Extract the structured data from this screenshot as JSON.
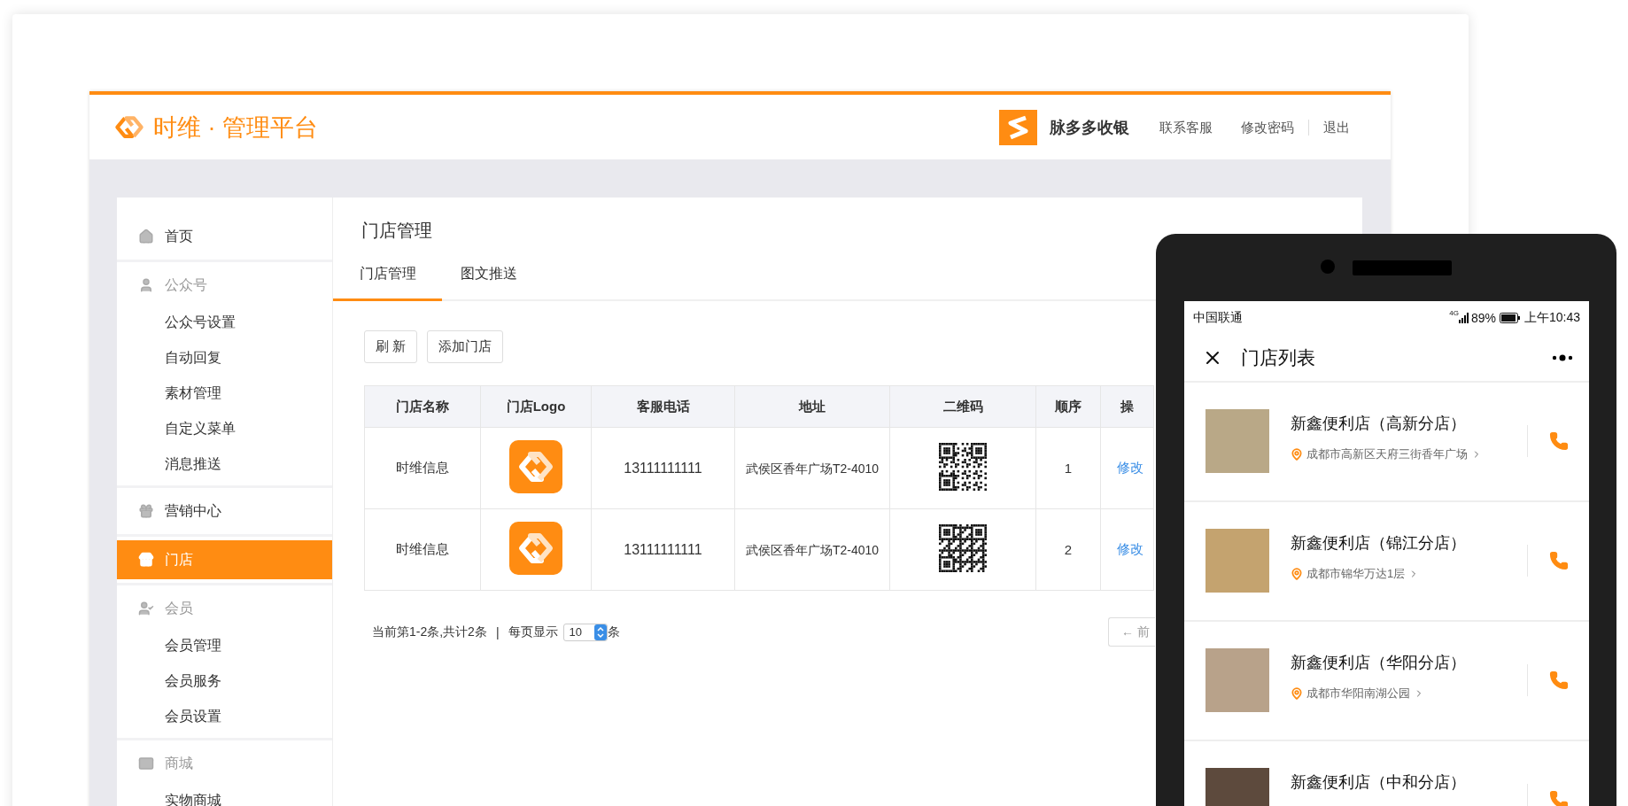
{
  "header": {
    "brand": "时维 · 管理平台",
    "app_name": "脉多多收银",
    "links": [
      "联系客服",
      "修改密码",
      "退出"
    ]
  },
  "sidebar": {
    "items": [
      {
        "label": "首页",
        "kind": "link",
        "selected": false
      },
      {
        "label": "公众号",
        "kind": "group",
        "selected": false,
        "children": [
          {
            "label": "公众号设置",
            "selected": false
          },
          {
            "label": "自动回复",
            "selected": false
          },
          {
            "label": "素材管理",
            "selected": false
          },
          {
            "label": "自定义菜单",
            "selected": false
          },
          {
            "label": "消息推送",
            "selected": false
          }
        ]
      },
      {
        "label": "营销中心",
        "kind": "link",
        "selected": false
      },
      {
        "label": "门店",
        "kind": "link",
        "selected": true
      },
      {
        "label": "会员",
        "kind": "group",
        "selected": false,
        "children": [
          {
            "label": "会员管理",
            "selected": false
          },
          {
            "label": "会员服务",
            "selected": false
          },
          {
            "label": "会员设置",
            "selected": false
          }
        ]
      },
      {
        "label": "商城",
        "kind": "group",
        "selected": false,
        "children": [
          {
            "label": "实物商城",
            "selected": false
          }
        ]
      }
    ]
  },
  "content": {
    "title": "门店管理",
    "tabs": [
      {
        "label": "门店管理",
        "selected": true
      },
      {
        "label": "图文推送",
        "selected": false
      }
    ],
    "buttons": [
      "刷 新",
      "添加门店"
    ],
    "table": {
      "columns": [
        "门店名称",
        "门店Logo",
        "客服电话",
        "地址",
        "二维码",
        "顺序",
        "操"
      ],
      "rows": [
        {
          "name": "时维信息",
          "phone": "13111111111",
          "address": "武侯区香年广场T2-4010",
          "order": "1",
          "action": "修改"
        },
        {
          "name": "时维信息",
          "phone": "13111111111",
          "address": "武侯区香年广场T2-4010",
          "order": "2",
          "action": "修改"
        }
      ]
    },
    "pager": {
      "summary": "当前第1-2条,共计2条",
      "separator": "|",
      "per_page_label": "每页显示",
      "per_page": "10",
      "unit": "条",
      "prev": "← 前"
    }
  },
  "phone": {
    "status": {
      "carrier": "中国联通",
      "network": "4G",
      "battery": "89%",
      "time": "上午10:43"
    },
    "title": "门店列表",
    "stores": [
      {
        "name": "新鑫便利店（高新分店）",
        "address": "成都市高新区天府三街香年广场"
      },
      {
        "name": "新鑫便利店（锦江分店）",
        "address": "成都市锦华万达1层"
      },
      {
        "name": "新鑫便利店（华阳分店）",
        "address": "成都市华阳南湖公园"
      },
      {
        "name": "新鑫便利店（中和分店）"
      }
    ]
  }
}
